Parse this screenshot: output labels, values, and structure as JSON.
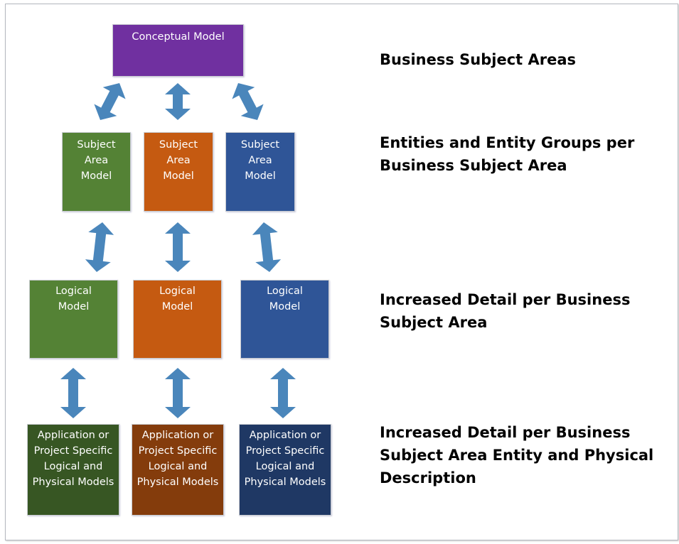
{
  "colors": {
    "arrow": "#4a86bb",
    "purple": "#7030a0",
    "green": "#548235",
    "orange": "#c55a11",
    "blue": "#2f5597",
    "dark_green": "#375623",
    "dark_orange": "#843c0c",
    "dark_blue": "#1f3864"
  },
  "conceptual": {
    "text": "Conceptual Model"
  },
  "subject_area": [
    {
      "text": "Subject\nArea\nModel"
    },
    {
      "text": "Subject\nArea\nModel"
    },
    {
      "text": "Subject\nArea\nModel"
    }
  ],
  "logical": [
    {
      "text": "Logical\nModel"
    },
    {
      "text": "Logical\nModel"
    },
    {
      "text": "Logical\nModel"
    }
  ],
  "physical": [
    {
      "text": "Application or\nProject Specific\nLogical and\nPhysical Models"
    },
    {
      "text": "Application or\nProject Specific\nLogical and\nPhysical Models"
    },
    {
      "text": "Application or\nProject Specific\nLogical and\nPhysical Models"
    }
  ],
  "labels": [
    {
      "text": "Business Subject Areas"
    },
    {
      "text": "Entities and Entity Groups per\nBusiness Subject Area"
    },
    {
      "text": "Increased Detail per Business\nSubject Area"
    },
    {
      "text": "Increased Detail per Business\nSubject Area Entity and Physical\nDescription"
    }
  ],
  "arrow_icon": "double-headed-arrow"
}
